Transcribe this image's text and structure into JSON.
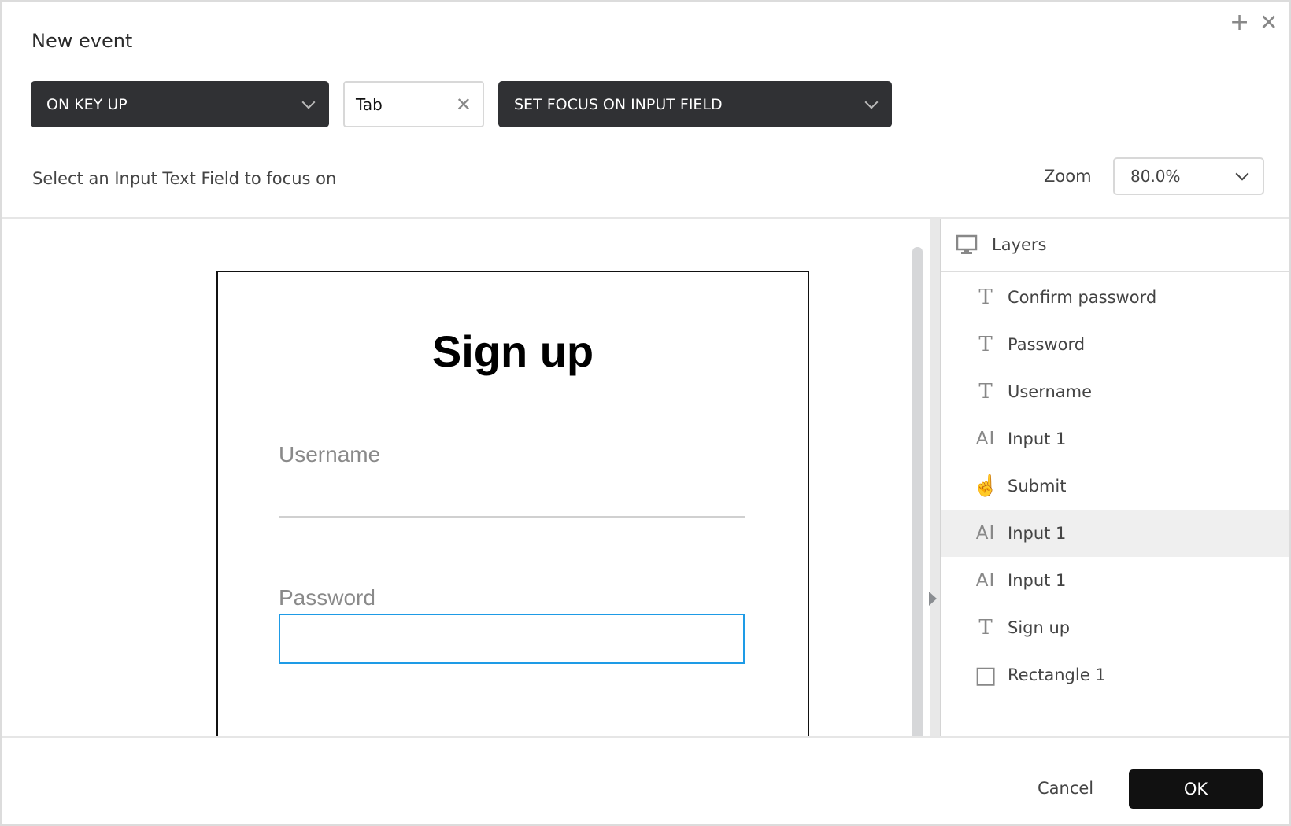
{
  "dialog": {
    "title": "New event"
  },
  "header_icons": [
    "plus-icon",
    "close-icon"
  ],
  "trigger": {
    "selected": "ON KEY UP"
  },
  "key_input": {
    "value": "Tab"
  },
  "action": {
    "selected": "SET FOCUS ON INPUT FIELD"
  },
  "hint": "Select an Input Text Field to focus on",
  "zoom": {
    "label": "Zoom",
    "value": "80.0%"
  },
  "preview": {
    "heading": "Sign up",
    "username_label": "Username",
    "password_label": "Password"
  },
  "colors": {
    "focus_highlight": "#1e9be6",
    "dark_button": "#303134",
    "ok_button": "#111111"
  },
  "layers": {
    "title": "Layers",
    "items": [
      {
        "label": "Confirm password",
        "icon": "text-icon"
      },
      {
        "label": "Password",
        "icon": "text-icon"
      },
      {
        "label": "Username",
        "icon": "text-icon"
      },
      {
        "label": "Input 1",
        "icon": "input-field-icon"
      },
      {
        "label": "Submit",
        "icon": "button-icon"
      },
      {
        "label": "Input 1",
        "icon": "input-field-icon",
        "selected": true
      },
      {
        "label": "Input 1",
        "icon": "input-field-icon"
      },
      {
        "label": "Sign up",
        "icon": "text-icon"
      },
      {
        "label": "Rectangle 1",
        "icon": "rectangle-icon"
      }
    ]
  },
  "footer": {
    "cancel": "Cancel",
    "ok": "OK"
  }
}
